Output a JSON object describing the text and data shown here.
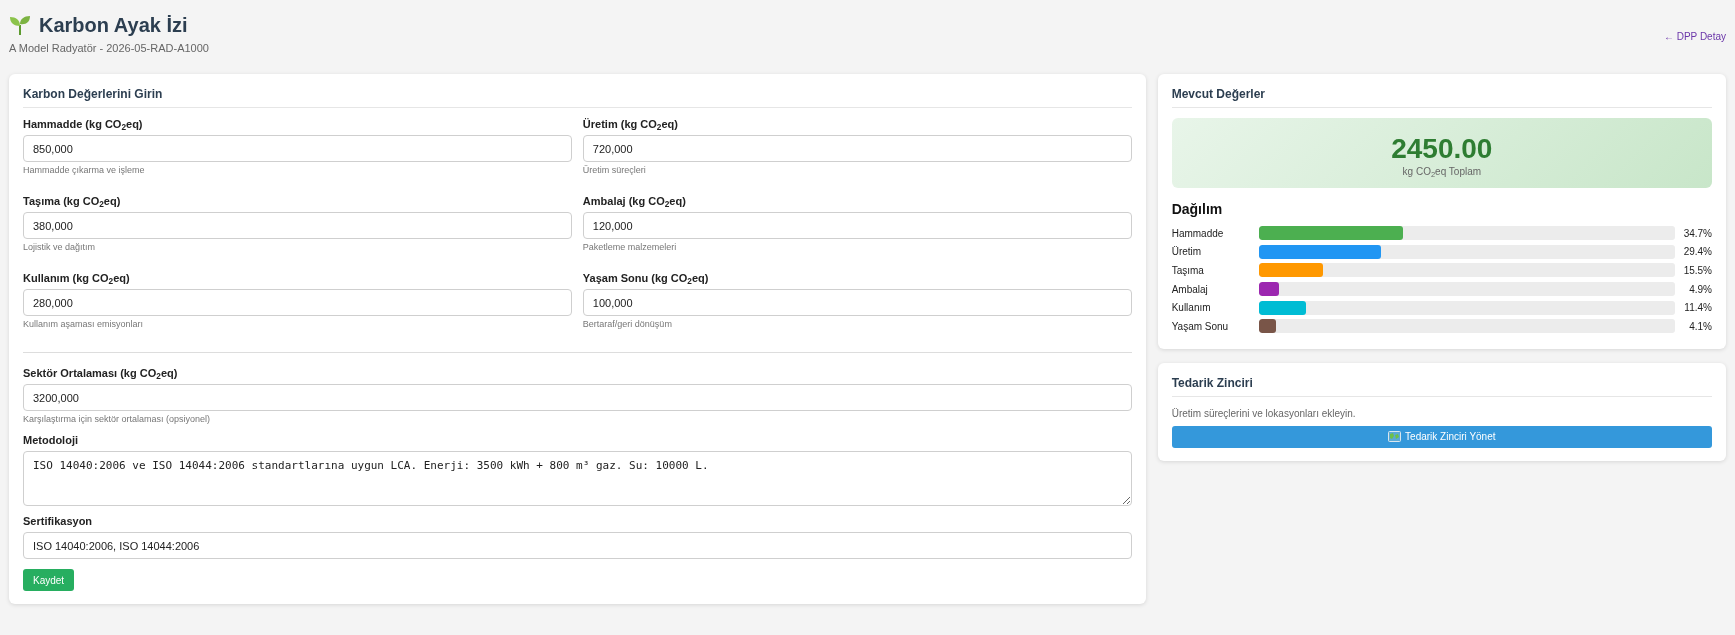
{
  "header": {
    "title": "Karbon Ayak İzi",
    "subtitle": "A Model Radyatör - 2026-05-RAD-A1000",
    "back_link": "← DPP Detay"
  },
  "form": {
    "title": "Karbon Değerlerini Girin",
    "fields": [
      {
        "label": "Hammadde (kg CO$_{2}$eq)",
        "value": "850,000",
        "help": "Hammadde çıkarma ve işleme"
      },
      {
        "label": "Üretim (kg CO$_{2}$eq)",
        "value": "720,000",
        "help": "Üretim süreçleri"
      },
      {
        "label": "Taşıma (kg CO$_{2}$eq)",
        "value": "380,000",
        "help": "Lojistik ve dağıtım"
      },
      {
        "label": "Ambalaj (kg CO$_{2}$eq)",
        "value": "120,000",
        "help": "Paketleme malzemeleri"
      },
      {
        "label": "Kullanım (kg CO$_{2}$eq)",
        "value": "280,000",
        "help": "Kullanım aşaması emisyonları"
      },
      {
        "label": "Yaşam Sonu (kg CO$_{2}$eq)",
        "value": "100,000",
        "help": "Bertaraf/geri dönüşüm"
      }
    ],
    "details": [
      {
        "kind": "input",
        "label": "Sektör Ortalaması (kg CO$_{2}$eq)",
        "value": "3200,000",
        "help": "Karşılaştırma için sektör ortalaması (opsiyonel)"
      },
      {
        "kind": "textarea",
        "label": "Metodoloji",
        "value": "ISO 14040:2006 ve ISO 14044:2006 standartlarına uygun LCA. Enerji: 3500 kWh + 800 m³ gaz. Su: 10000 L."
      },
      {
        "kind": "input",
        "label": "Sertifikasyon",
        "value": "ISO 14040:2006, ISO 14044:2006"
      }
    ],
    "save_button": "Kaydet"
  },
  "summary": {
    "title": "Mevcut Değerler",
    "total": "2450.00",
    "total_label": "kg CO$_{2}$eq Toplam",
    "breakdown_title": "Dağılım",
    "breakdown": [
      {
        "name": "Hammadde",
        "level": 0.347,
        "reading": "34.7%",
        "color": "#4caf50"
      },
      {
        "name": "Üretim",
        "level": 0.294,
        "reading": "29.4%",
        "color": "#2196f3"
      },
      {
        "name": "Taşıma",
        "level": 0.155,
        "reading": "15.5%",
        "color": "#ff9800"
      },
      {
        "name": "Ambalaj",
        "level": 0.049,
        "reading": "4.9%",
        "color": "#9c27b0"
      },
      {
        "name": "Kullanım",
        "level": 0.114,
        "reading": "11.4%",
        "color": "#00bcd4"
      },
      {
        "name": "Yaşam Sonu",
        "level": 0.041,
        "reading": "4.1%",
        "color": "#795548"
      }
    ]
  },
  "supply_chain": {
    "title": "Tedarik Zinciri",
    "text": "Üretim süreçlerini ve lokasyonları ekleyin.",
    "button": "Tedarik Zinciri Yönet"
  }
}
